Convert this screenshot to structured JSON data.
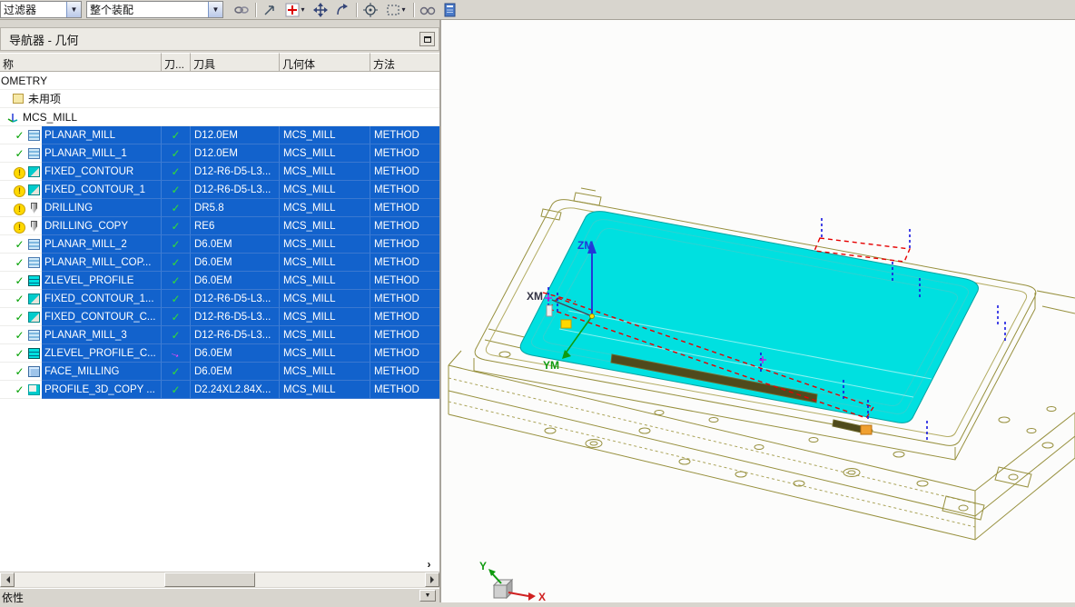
{
  "toolbar": {
    "filter_combo": "过滤器",
    "scope_combo": "整个装配",
    "dropdown_glyph": "▼",
    "icons": [
      "link-icon",
      "snap-arrow-icon",
      "create-node-icon",
      "move-object-icon",
      "transform-icon",
      "point-icon",
      "selection-rect-icon",
      "show-hide-icon",
      "notebook-icon"
    ]
  },
  "navigator": {
    "title": "导航器 - 几何",
    "columns": {
      "name": "称",
      "path": "刀...",
      "tool": "刀具",
      "geometry": "几何体",
      "method": "方法"
    },
    "tree": {
      "root": "OMETRY",
      "unused": "未用项",
      "mcs": "MCS_MILL"
    },
    "operations": [
      {
        "status": "ok",
        "icon": "planar",
        "name": "PLANAR_MILL",
        "path": "ok",
        "tool": "D12.0EM",
        "geometry": "MCS_MILL",
        "method": "METHOD"
      },
      {
        "status": "ok",
        "icon": "planar",
        "name": "PLANAR_MILL_1",
        "path": "ok",
        "tool": "D12.0EM",
        "geometry": "MCS_MILL",
        "method": "METHOD"
      },
      {
        "status": "warn",
        "icon": "contour",
        "name": "FIXED_CONTOUR",
        "path": "ok",
        "tool": "D12-R6-D5-L3...",
        "geometry": "MCS_MILL",
        "method": "METHOD"
      },
      {
        "status": "warn",
        "icon": "contour",
        "name": "FIXED_CONTOUR_1",
        "path": "ok",
        "tool": "D12-R6-D5-L3...",
        "geometry": "MCS_MILL",
        "method": "METHOD"
      },
      {
        "status": "warn",
        "icon": "drill",
        "name": "DRILLING",
        "path": "ok",
        "tool": "DR5.8",
        "geometry": "MCS_MILL",
        "method": "METHOD"
      },
      {
        "status": "warn",
        "icon": "drill",
        "name": "DRILLING_COPY",
        "path": "ok",
        "tool": "RE6",
        "geometry": "MCS_MILL",
        "method": "METHOD"
      },
      {
        "status": "ok",
        "icon": "planar",
        "name": "PLANAR_MILL_2",
        "path": "ok",
        "tool": "D6.0EM",
        "geometry": "MCS_MILL",
        "method": "METHOD"
      },
      {
        "status": "ok",
        "icon": "planar",
        "name": "PLANAR_MILL_COP...",
        "path": "ok",
        "tool": "D6.0EM",
        "geometry": "MCS_MILL",
        "method": "METHOD"
      },
      {
        "status": "ok",
        "icon": "zlevel",
        "name": "ZLEVEL_PROFILE",
        "path": "ok",
        "tool": "D6.0EM",
        "geometry": "MCS_MILL",
        "method": "METHOD"
      },
      {
        "status": "ok",
        "icon": "contour",
        "name": "FIXED_CONTOUR_1...",
        "path": "ok",
        "tool": "D12-R6-D5-L3...",
        "geometry": "MCS_MILL",
        "method": "METHOD"
      },
      {
        "status": "ok",
        "icon": "contour",
        "name": "FIXED_CONTOUR_C...",
        "path": "ok",
        "tool": "D12-R6-D5-L3...",
        "geometry": "MCS_MILL",
        "method": "METHOD"
      },
      {
        "status": "ok",
        "icon": "planar",
        "name": "PLANAR_MILL_3",
        "path": "ok",
        "tool": "D12-R6-D5-L3...",
        "geometry": "MCS_MILL",
        "method": "METHOD"
      },
      {
        "status": "ok",
        "icon": "zlevel",
        "name": "ZLEVEL_PROFILE_C...",
        "path": "arrow",
        "tool": "D6.0EM",
        "geometry": "MCS_MILL",
        "method": "METHOD"
      },
      {
        "status": "ok",
        "icon": "face",
        "name": "FACE_MILLING",
        "path": "ok",
        "tool": "D6.0EM",
        "geometry": "MCS_MILL",
        "method": "METHOD"
      },
      {
        "status": "ok",
        "icon": "profile",
        "name": "PROFILE_3D_COPY ...",
        "path": "ok",
        "tool": "D2.24XL2.84X...",
        "geometry": "MCS_MILL",
        "method": "METHOD"
      }
    ],
    "scroll_right_glyph": "›",
    "bottom_label": "依性",
    "bottom_chevron": "▼"
  },
  "viewport": {
    "axis_labels": {
      "zm": "ZM",
      "ym": "YM",
      "xm": "XM",
      "x": "X",
      "y": "Y"
    },
    "colors": {
      "highlight_body": "#00e0e0",
      "wireframe": "#97903e",
      "toolpath_cut": "#e60000",
      "toolpath_traverse": "#1717e0",
      "selection_row": "#1262cc"
    }
  }
}
